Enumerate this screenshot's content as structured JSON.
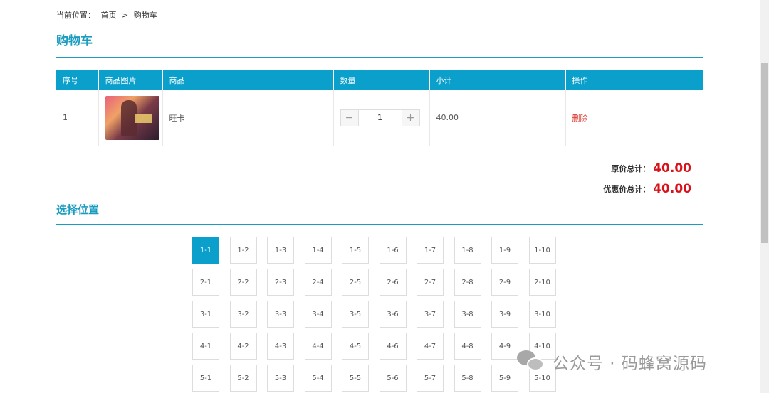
{
  "breadcrumb": {
    "prefix": "当前位置：",
    "home": "首页",
    "separator": ">",
    "current": "购物车"
  },
  "cart": {
    "title": "购物车",
    "columns": [
      "序号",
      "商品图片",
      "商品",
      "数量",
      "小计",
      "操作"
    ],
    "rows": [
      {
        "index": "1",
        "product_name": "旺卡",
        "quantity": "1",
        "subtotal": "40.00",
        "action_label": "删除",
        "decrement": "−",
        "increment": "+"
      }
    ]
  },
  "totals": {
    "original_label": "原价总计：",
    "original_value": "40.00",
    "discount_label": "优惠价总计：",
    "discount_value": "40.00"
  },
  "seats": {
    "title": "选择位置",
    "selected": "1-1",
    "rows": [
      [
        "1-1",
        "1-2",
        "1-3",
        "1-4",
        "1-5",
        "1-6",
        "1-7",
        "1-8",
        "1-9",
        "1-10"
      ],
      [
        "2-1",
        "2-2",
        "2-3",
        "2-4",
        "2-5",
        "2-6",
        "2-7",
        "2-8",
        "2-9",
        "2-10"
      ],
      [
        "3-1",
        "3-2",
        "3-3",
        "3-4",
        "3-5",
        "3-6",
        "3-7",
        "3-8",
        "3-9",
        "3-10"
      ],
      [
        "4-1",
        "4-2",
        "4-3",
        "4-4",
        "4-5",
        "4-6",
        "4-7",
        "4-8",
        "4-9",
        "4-10"
      ],
      [
        "5-1",
        "5-2",
        "5-3",
        "5-4",
        "5-5",
        "5-6",
        "5-7",
        "5-8",
        "5-9",
        "5-10"
      ]
    ]
  },
  "watermark": {
    "text": "公众号 · 码蜂窝源码",
    "icon": "wechat-icon"
  },
  "colors": {
    "accent": "#0ba0cb",
    "price": "#d7121b",
    "delete": "#d9342b"
  }
}
